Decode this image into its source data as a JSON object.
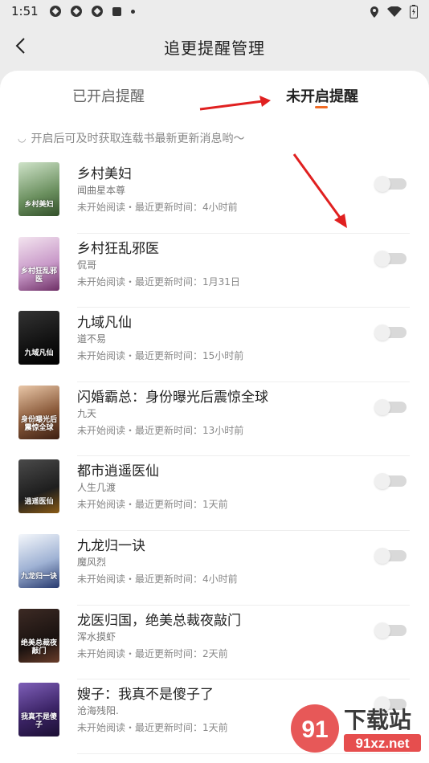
{
  "status": {
    "time": "1:51"
  },
  "header": {
    "title": "追更提醒管理"
  },
  "tabs": {
    "enabled": "已开启提醒",
    "disabled": "未开启提醒"
  },
  "tip": "开启后可及时获取连载书最新更新消息哟～",
  "colors": {
    "accent": "#f06a23",
    "annotation_arrow": "#e02020"
  },
  "books": [
    {
      "title": "乡村美妇",
      "author": "闻曲星本尊",
      "meta": "未开始阅读・最近更新时间：4小时前",
      "cover_text": "乡村美妇",
      "cover_bg": "linear-gradient(160deg,#cfe3c9,#6a8f5e 60%,#33502a)"
    },
    {
      "title": "乡村狂乱邪医",
      "author": "侃哥",
      "meta": "未开始阅读・最近更新时间：1月31日",
      "cover_text": "乡村狂乱邪医",
      "cover_bg": "linear-gradient(160deg,#f3e4ef,#c99ac9 55%,#6e2f66)"
    },
    {
      "title": "九域凡仙",
      "author": "道不易",
      "meta": "未开始阅读・最近更新时间：15小时前",
      "cover_text": "九域凡仙",
      "cover_bg": "linear-gradient(160deg,#333,#111 60%,#000)"
    },
    {
      "title": "闪婚霸总：身份曝光后震惊全球",
      "author": "九天",
      "meta": "未开始阅读・最近更新时间：13小时前",
      "cover_text": "身份曝光后震惊全球",
      "cover_bg": "linear-gradient(160deg,#e9c7a8,#8a5a3a 55%,#3b1e12)"
    },
    {
      "title": "都市逍遥医仙",
      "author": "人生几渡",
      "meta": "未开始阅读・最近更新时间：1天前",
      "cover_text": "逍遥医仙",
      "cover_bg": "linear-gradient(160deg,#4a4a4a,#1e1e1e 60%,#8a5b16)"
    },
    {
      "title": "九龙归一诀",
      "author": "魔风烈",
      "meta": "未开始阅读・最近更新时间：4小时前",
      "cover_text": "九龙归一诀",
      "cover_bg": "linear-gradient(160deg,#f4f7fb,#9fb2d4 55%,#26396e)"
    },
    {
      "title": "龙医归国，绝美总裁夜敲门",
      "author": "浑水摸虾",
      "meta": "未开始阅读・最近更新时间：2天前",
      "cover_text": "绝美总裁夜敲门",
      "cover_bg": "linear-gradient(160deg,#3c2a24,#1a1210 60%,#6a3d2a)"
    },
    {
      "title": "嫂子：我真不是傻子了",
      "author": "沧海残阳.",
      "meta": "未开始阅读・最近更新时间：1天前",
      "cover_text": "我真不是傻子",
      "cover_bg": "linear-gradient(160deg,#7e5fb8,#3c2467 55%,#1b0f33)"
    }
  ],
  "watermark": {
    "brand": "下载站",
    "site": "91xz.net",
    "logo_text": "91"
  }
}
